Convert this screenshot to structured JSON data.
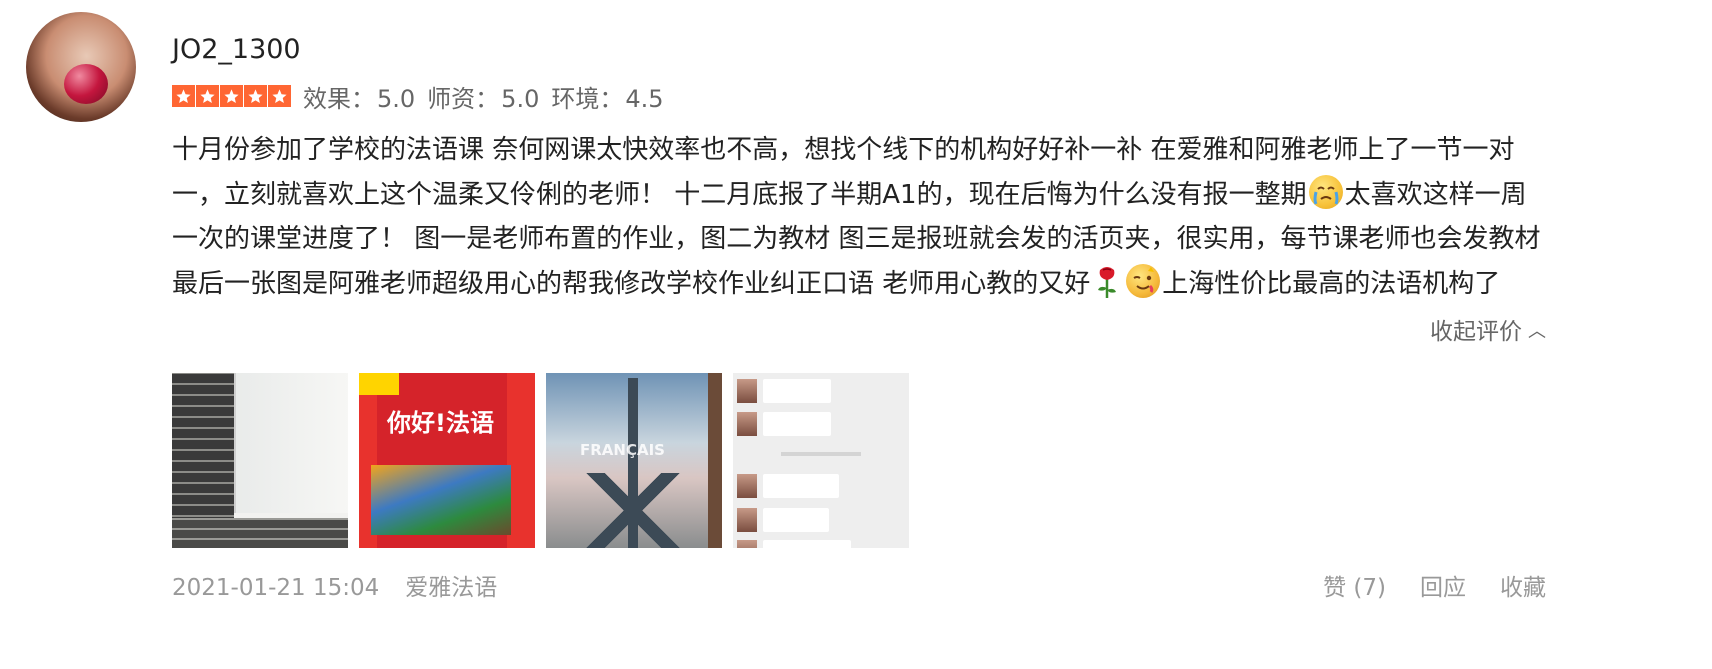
{
  "user": {
    "name": "JO2_1300",
    "avatar_icon": "user-avatar-photo"
  },
  "rating": {
    "stars": 5,
    "star_color": "#ff6633",
    "scores": [
      {
        "label": "效果：",
        "value": "5.0"
      },
      {
        "label": "师资：",
        "value": "5.0"
      },
      {
        "label": "环境：",
        "value": "4.5"
      }
    ]
  },
  "review": {
    "part1": "十月份参加了学校的法语课 奈何网课太快效率也不高，想找个线下的机构好好补一补 在爱雅和阿雅老师上了一节一对一，立刻就喜欢上这个温柔又伶俐的老师！ 十二月底报了半期A1的，现在后悔为什么没有报一整期",
    "part2": "太喜欢这样一周一次的课堂进度了！ 图一是老师布置的作业，图二为教材 图三是报班就会发的活页夹，很实用，每节课老师也会发教材 最后一张图是阿雅老师超级用心的帮我修改学校作业纠正口语 老师用心教的又好",
    "part3": "上海性价比最高的法语机构了",
    "emoji_1": "crying-face-emoji",
    "emoji_2": "rose-emoji",
    "emoji_3": "winking-face-emoji"
  },
  "collapse_label": "收起评价",
  "photos": [
    {
      "name": "homework-whiteboard-photo"
    },
    {
      "name": "textbook-photo",
      "title": "你好!法语"
    },
    {
      "name": "binder-photo",
      "caption": "FRANÇAIS"
    },
    {
      "name": "chat-screenshot-photo"
    }
  ],
  "footer": {
    "timestamp": "2021-01-21 15:04",
    "shop": "爱雅法语",
    "like_label": "赞",
    "like_count": "(7)",
    "reply_label": "回应",
    "favorite_label": "收藏"
  }
}
